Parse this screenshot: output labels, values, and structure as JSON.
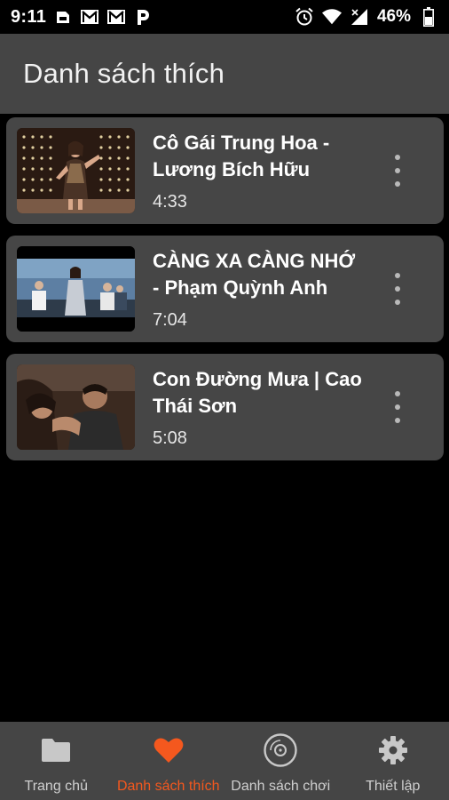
{
  "status_bar": {
    "time": "9:11",
    "battery": "46%",
    "left_icons": [
      "sim-card-icon",
      "gmail-icon",
      "gmail-icon",
      "p-app-icon"
    ],
    "right_icons": [
      "alarm-icon",
      "wifi-icon",
      "cellular-signal-icon",
      "battery-icon"
    ]
  },
  "app_bar": {
    "title": "Danh sách thích"
  },
  "videos": [
    {
      "title": "Cô Gái Trung Hoa - Lương Bích Hữu",
      "duration": "4:33"
    },
    {
      "title": "CÀNG XA CÀNG NHỚ - Phạm Quỳnh Anh",
      "duration": "7:04"
    },
    {
      "title": "Con Đường Mưa | Cao Thái Sơn",
      "duration": "5:08"
    }
  ],
  "bottom_nav": {
    "accent_color": "#f4581e",
    "items": [
      {
        "label": "Trang chủ",
        "icon": "folder-icon",
        "active": false
      },
      {
        "label": "Danh sách thích",
        "icon": "heart-icon",
        "active": true
      },
      {
        "label": "Danh sách chơi",
        "icon": "disc-icon",
        "active": false
      },
      {
        "label": "Thiết lập",
        "icon": "gear-icon",
        "active": false
      }
    ]
  }
}
